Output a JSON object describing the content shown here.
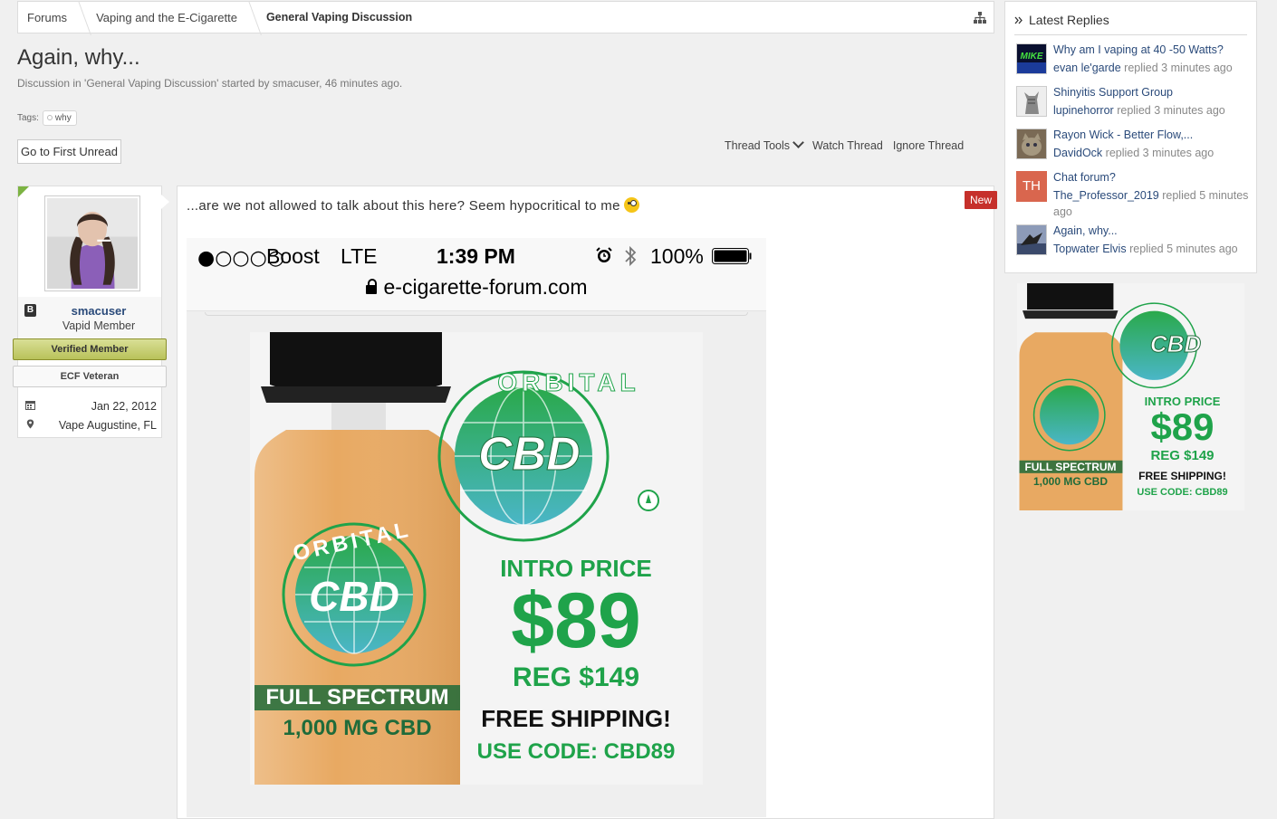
{
  "breadcrumb": {
    "items": [
      "Forums",
      "Vaping and the E-Cigarette",
      "General Vaping Discussion"
    ]
  },
  "thread": {
    "title": "Again, why...",
    "meta": "Discussion in 'General Vaping Discussion' started by smacuser, 46 minutes ago.",
    "tags_label": "Tags:",
    "tags": [
      "why"
    ],
    "first_unread": "Go to First Unread",
    "tools": {
      "thread_tools": "Thread Tools",
      "watch": "Watch Thread",
      "ignore": "Ignore Thread"
    }
  },
  "user": {
    "name": "smacuser",
    "title": "Vapid Member",
    "badge_letter": "B",
    "banners": [
      "Verified Member",
      "ECF Veteran"
    ],
    "joined": "Jan 22, 2012",
    "location": "Vape Augustine, FL"
  },
  "post": {
    "new_label": "New",
    "text": "...are we not allowed to talk about this here? Seem hypocritical to me",
    "phone_status": {
      "signal": "●○○○○",
      "carrier": "Boost",
      "network": "LTE",
      "time": "1:39 PM",
      "battery": "100%",
      "url": "e-cigarette-forum.com"
    }
  },
  "ad": {
    "brand_top": "ORBITAL",
    "brand": "CBD",
    "intro": "INTRO PRICE",
    "price": "$89",
    "reg": "REG $149",
    "shipping": "FREE SHIPPING!",
    "code": "USE CODE: CBD89",
    "label1": "FULL SPECTRUM",
    "label2": "1,000 MG CBD",
    "colors": {
      "green": "#1fa34a",
      "bottle": "#e8a962"
    }
  },
  "sidebar": {
    "heading": "Latest Replies",
    "replies": [
      {
        "title": "Why am I vaping at 40 -50 Watts?",
        "user": "evan le'garde",
        "replied": "replied 3 minutes ago",
        "avatar_text": "MIKE"
      },
      {
        "title": "Shinyitis Support Group",
        "user": "lupinehorror",
        "replied": "replied 3 minutes ago",
        "avatar_text": ""
      },
      {
        "title": "Rayon Wick - Better Flow,...",
        "user": "DavidOck",
        "replied": "replied 3 minutes ago",
        "avatar_text": ""
      },
      {
        "title": "Chat forum?",
        "user": "The_Professor_2019",
        "replied": "replied 5 minutes ago",
        "avatar_text": "TH"
      },
      {
        "title": "Again, why...",
        "user": "Topwater Elvis",
        "replied": "replied 5 minutes ago",
        "avatar_text": ""
      }
    ]
  }
}
